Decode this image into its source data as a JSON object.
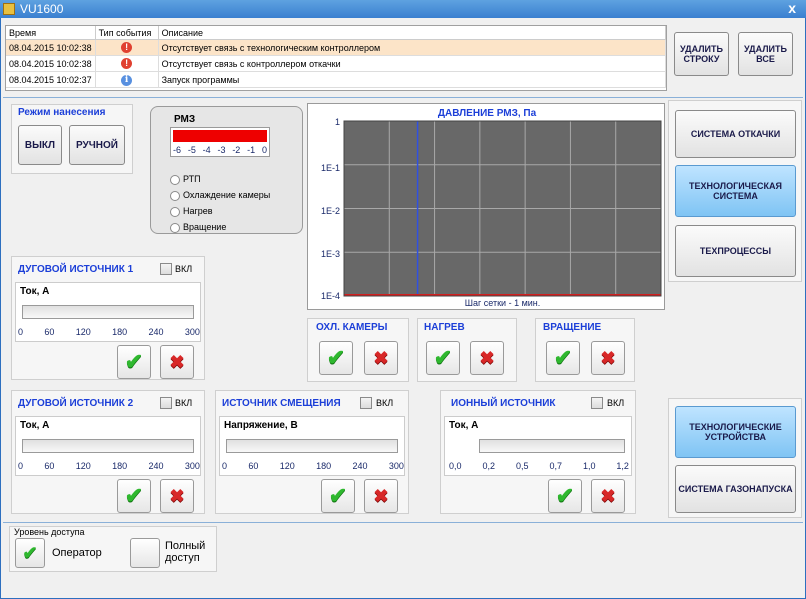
{
  "window": {
    "title": "VU1600",
    "close_glyph": "x"
  },
  "log": {
    "columns": [
      "Время",
      "Тип события",
      "Описание"
    ],
    "rows": [
      {
        "time": "08.04.2015 10:02:38",
        "type": "error",
        "text": "Отсутствует связь с технологическим контроллером"
      },
      {
        "time": "08.04.2015 10:02:38",
        "type": "error",
        "text": "Отсутствует связь с контроллером откачки"
      },
      {
        "time": "08.04.2015 10:02:37",
        "type": "info",
        "text": "Запуск программы"
      }
    ],
    "delete_row": "УДАЛИТЬ СТРОКУ",
    "delete_all": "УДАЛИТЬ ВСЕ"
  },
  "mode": {
    "title": "Режим нанесения",
    "off": "ВЫКЛ",
    "manual": "РУЧНОЙ"
  },
  "rmz": {
    "title": "РМЗ",
    "scale": [
      "-6",
      "-5",
      "-4",
      "-3",
      "-2",
      "-1",
      "0"
    ],
    "options": [
      "РТП",
      "Охлаждение камеры",
      "Нагрев",
      "Вращение"
    ]
  },
  "chart_data": {
    "type": "line",
    "title": "ДАВЛЕНИЕ РМЗ, Па",
    "y_ticks": [
      "1",
      "1E-1",
      "1E-2",
      "1E-3",
      "1E-4"
    ],
    "ylim": [
      0.0001,
      1
    ],
    "yscale": "log",
    "note": "Шаг сетки - 1 мин.",
    "series": [
      {
        "values": [
          0.0001,
          0.0001
        ]
      }
    ],
    "grid": true,
    "colors": {
      "background": "#686868",
      "grid": "#a8a8a8",
      "line": "#d02020",
      "marker": "#3050e0"
    }
  },
  "nav": {
    "pump": "СИСТЕМА ОТКАЧКИ",
    "tech": "ТЕХНОЛОГИЧЕСКАЯ СИСТЕМА",
    "processes": "ТЕХПРОЦЕССЫ",
    "devices": "ТЕХНОЛОГИЧЕСКИЕ УСТРОЙСТВА",
    "gas": "СИСТЕМА ГАЗОНАПУСКА"
  },
  "arc1": {
    "title": "ДУГОВОЙ ИСТОЧНИК 1",
    "enable": "ВКЛ",
    "measure": "Ток, А",
    "scale": [
      "0",
      "60",
      "120",
      "180",
      "240",
      "300"
    ],
    "level": 0
  },
  "arc2": {
    "title": "ДУГОВОЙ ИСТОЧНИК 2",
    "enable": "ВКЛ",
    "measure": "Ток, А",
    "scale": [
      "0",
      "60",
      "120",
      "180",
      "240",
      "300"
    ],
    "level": 0
  },
  "bias": {
    "title": "ИСТОЧНИК СМЕЩЕНИЯ",
    "enable": "ВКЛ",
    "measure": "Напряжение, В",
    "scale": [
      "0",
      "60",
      "120",
      "180",
      "240",
      "300"
    ],
    "level": 0
  },
  "ion": {
    "title": "ИОННЫЙ ИСТОЧНИК",
    "enable": "ВКЛ",
    "measure": "Ток, А",
    "scale": [
      "0,0",
      "0,2",
      "0,5",
      "0,7",
      "1,0",
      "1,2"
    ],
    "level": 0
  },
  "cooling": {
    "title": "ОХЛ. КАМЕРЫ"
  },
  "heating": {
    "title": "НАГРЕВ"
  },
  "rotation": {
    "title": "ВРАЩЕНИЕ"
  },
  "access": {
    "title": "Уровень доступа",
    "operator": "Оператор",
    "full": "Полный доступ"
  },
  "icons": {
    "ok": "✔",
    "cancel": "✖",
    "error": "!",
    "info": "i"
  }
}
